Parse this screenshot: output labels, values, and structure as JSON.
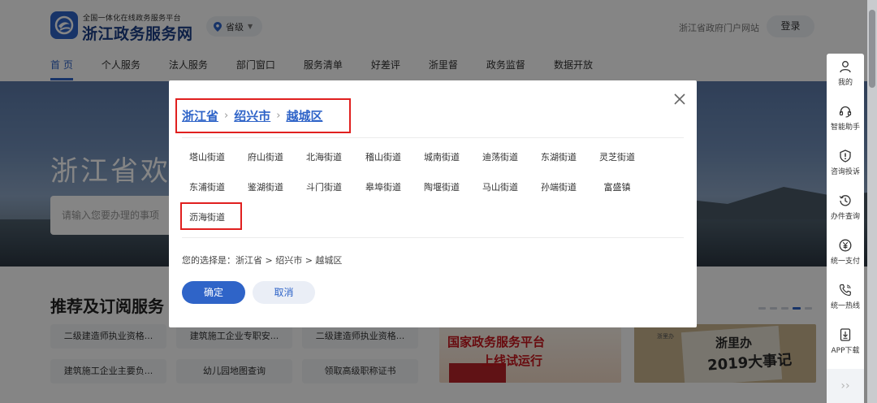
{
  "header": {
    "logo_subtitle": "全国一体化在线政务服务平台",
    "logo_title": "浙江政务服务网",
    "region": "省级",
    "portal_link": "浙江省政府门户网站",
    "login": "登录"
  },
  "nav": {
    "items": [
      "首 页",
      "个人服务",
      "法人服务",
      "部门窗口",
      "服务清单",
      "好差评",
      "浙里督",
      "政务监督",
      "数据开放"
    ]
  },
  "banner": {
    "title": "浙江省欢迎",
    "search_placeholder": "请输入您要办理的事项"
  },
  "recommend": {
    "title": "推荐及订阅服务",
    "tags": [
      "二级建造师执业资格...",
      "建筑施工企业专职安...",
      "二级建造师执业资格...",
      "建筑施工企业主要负...",
      "幼儿园地图查询",
      "领取高级职称证书"
    ]
  },
  "promos": {
    "promo1_line1": "国家政务服务平台",
    "promo1_line2": "上线试运行",
    "promo2_logo": "浙里办",
    "promo2_line1": "浙里办",
    "promo2_line2": "2019大事记"
  },
  "modal": {
    "breadcrumb": [
      "浙江省",
      "绍兴市",
      "越城区"
    ],
    "streets": [
      "塔山街道",
      "府山街道",
      "北海街道",
      "稽山街道",
      "城南街道",
      "迪荡街道",
      "东湖街道",
      "灵芝街道",
      "东浦街道",
      "鉴湖街道",
      "斗门街道",
      "皋埠街道",
      "陶堰街道",
      "马山街道",
      "孙端街道",
      "富盛镇",
      "沥海街道"
    ],
    "choice": "您的选择是：浙江省 > 绍兴市 > 越城区",
    "confirm": "确定",
    "cancel": "取消"
  },
  "sidebar": {
    "items": [
      "我的",
      "智能助手",
      "咨询投诉",
      "办件查询",
      "统一支付",
      "统一热线",
      "APP下载"
    ],
    "more": "››"
  },
  "colors": {
    "accent": "#2f64c8",
    "highlight_box": "#e0201f"
  }
}
